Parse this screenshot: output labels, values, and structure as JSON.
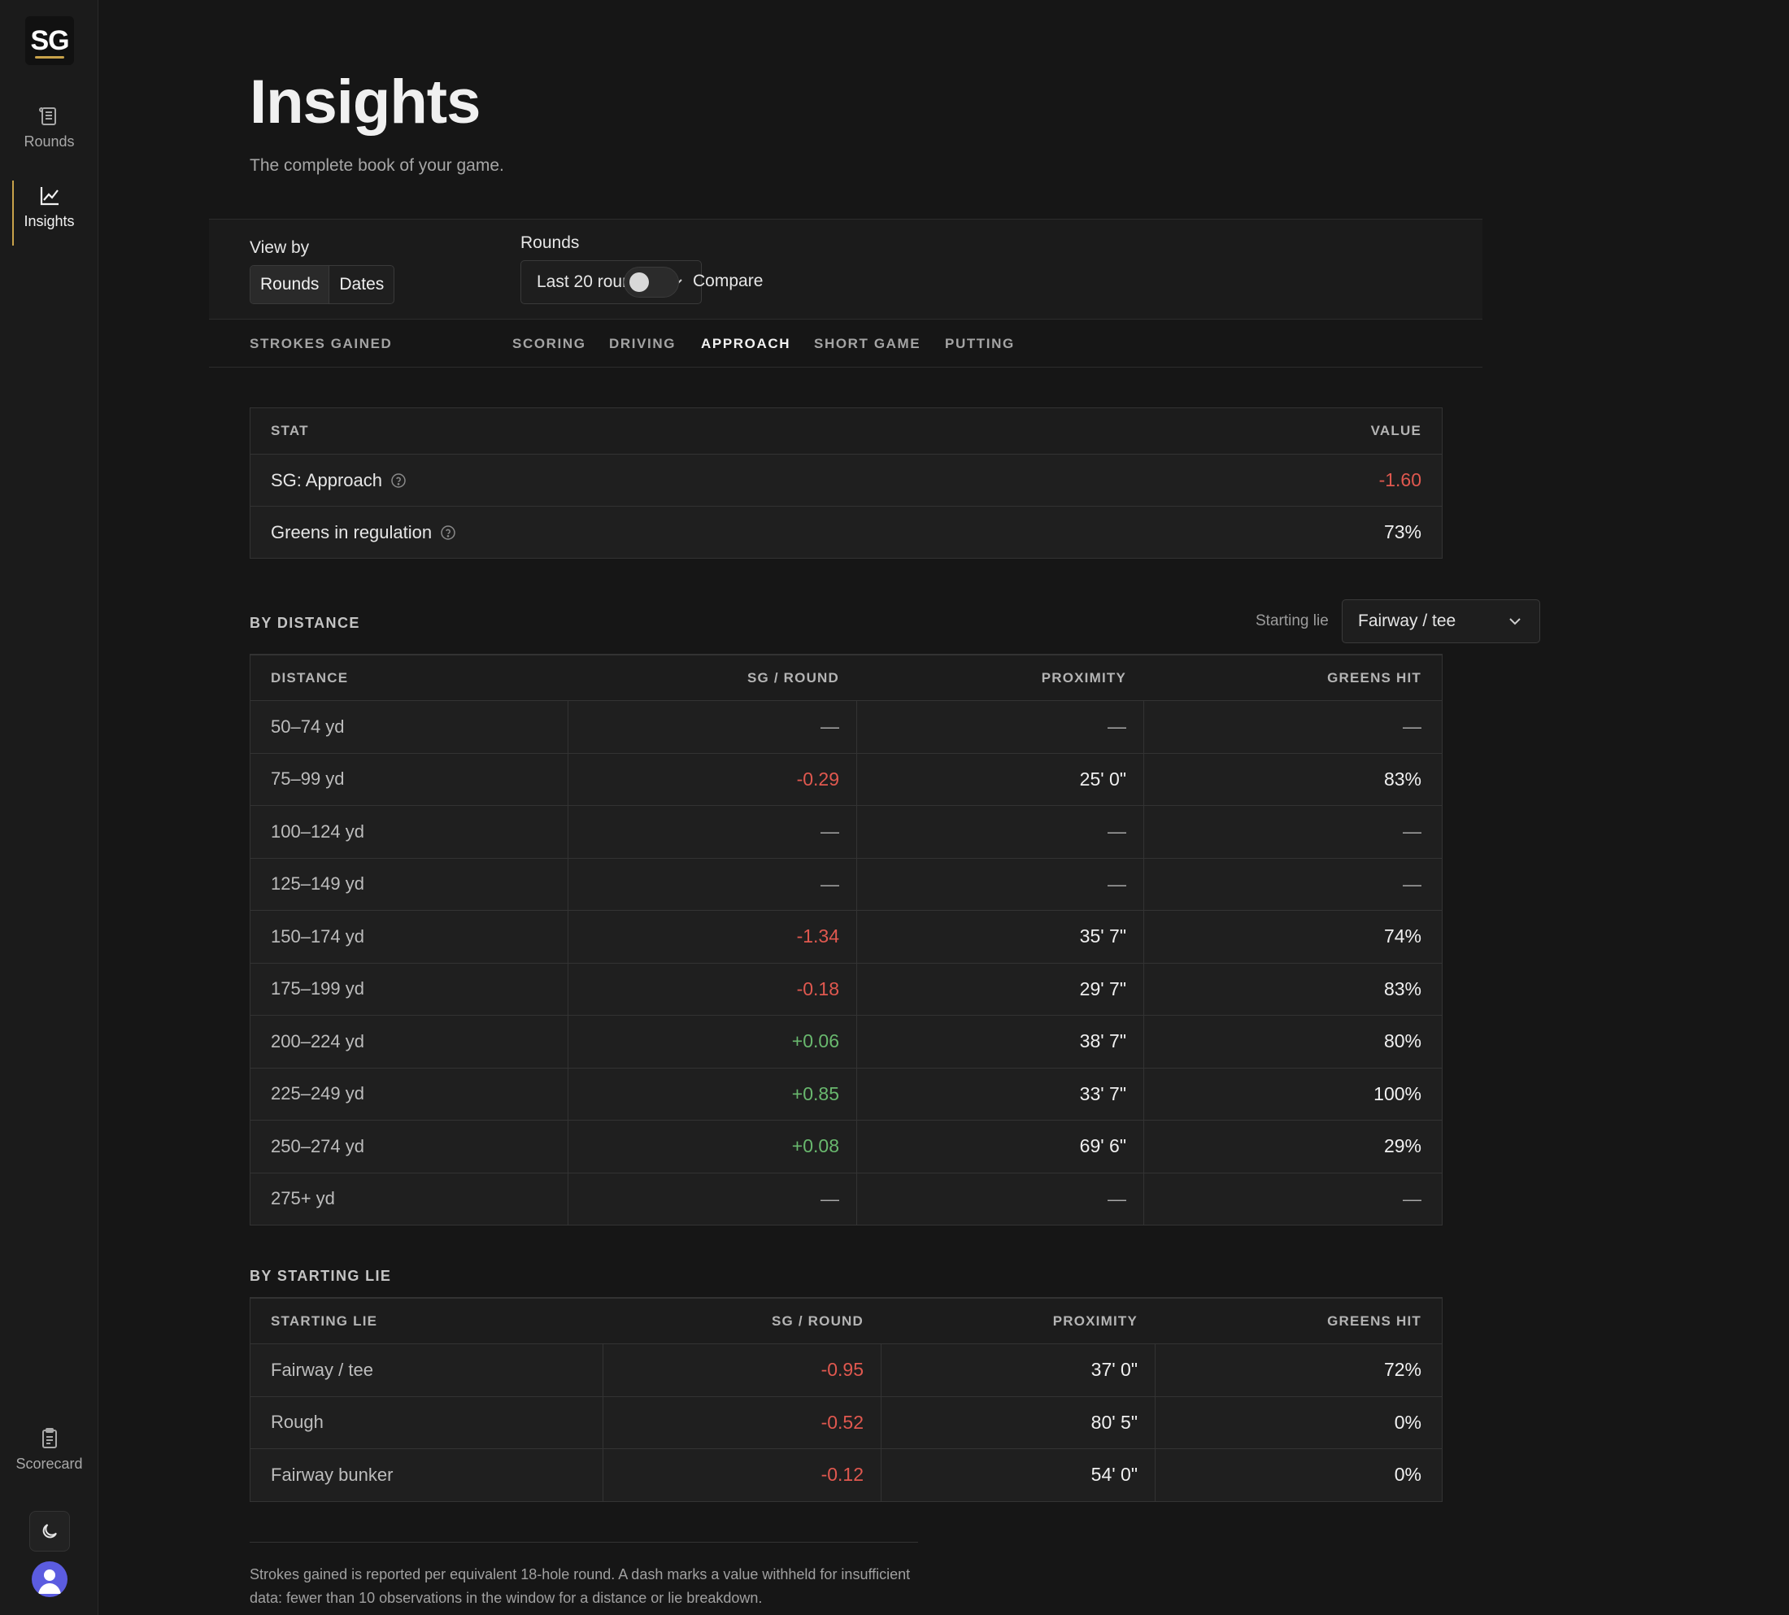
{
  "sidebar": {
    "logo": "SG",
    "nav": [
      {
        "label": "Rounds",
        "icon": "rounds-icon"
      },
      {
        "label": "Insights",
        "icon": "chart-icon"
      }
    ],
    "bottom": {
      "label": "Scorecard",
      "icon": "scorecard-icon"
    }
  },
  "page": {
    "title": "Insights",
    "subtitle": "The complete book of your game."
  },
  "controls": {
    "view_by_label": "View by",
    "view_by_options": [
      "Rounds",
      "Dates"
    ],
    "rounds_label": "Rounds",
    "rounds_value": "Last 20 rounds",
    "compare_label": "Compare"
  },
  "tabs": [
    "STROKES GAINED",
    "SCORING",
    "DRIVING",
    "APPROACH",
    "SHORT GAME",
    "PUTTING"
  ],
  "summary": {
    "headers": [
      "STAT",
      "VALUE"
    ],
    "rows": [
      {
        "stat": "SG: Approach",
        "value": "-1.60"
      },
      {
        "stat": "Greens in regulation",
        "value": "73%"
      }
    ]
  },
  "by_distance": {
    "title": "BY DISTANCE",
    "starting_lie_label": "Starting lie",
    "starting_lie_value": "Fairway / tee",
    "headers": [
      "DISTANCE",
      "SG / ROUND",
      "PROXIMITY",
      "GREENS HIT"
    ],
    "rows": [
      {
        "distance": "50–74 yd",
        "sg": "—",
        "prox": "—",
        "greens": "—"
      },
      {
        "distance": "75–99 yd",
        "sg": "-0.29",
        "prox": "25' 0\"",
        "greens": "83%"
      },
      {
        "distance": "100–124 yd",
        "sg": "—",
        "prox": "—",
        "greens": "—"
      },
      {
        "distance": "125–149 yd",
        "sg": "—",
        "prox": "—",
        "greens": "—"
      },
      {
        "distance": "150–174 yd",
        "sg": "-1.34",
        "prox": "35' 7\"",
        "greens": "74%"
      },
      {
        "distance": "175–199 yd",
        "sg": "-0.18",
        "prox": "29' 7\"",
        "greens": "83%"
      },
      {
        "distance": "200–224 yd",
        "sg": "+0.06",
        "prox": "38' 7\"",
        "greens": "80%"
      },
      {
        "distance": "225–249 yd",
        "sg": "+0.85",
        "prox": "33' 7\"",
        "greens": "100%"
      },
      {
        "distance": "250–274 yd",
        "sg": "+0.08",
        "prox": "69' 6\"",
        "greens": "29%"
      },
      {
        "distance": "275+ yd",
        "sg": "—",
        "prox": "—",
        "greens": "—"
      }
    ]
  },
  "by_lie": {
    "title": "BY STARTING LIE",
    "headers": [
      "STARTING LIE",
      "SG / ROUND",
      "PROXIMITY",
      "GREENS HIT"
    ],
    "rows": [
      {
        "lie": "Fairway / tee",
        "sg": "-0.95",
        "prox": "37' 0\"",
        "greens": "72%"
      },
      {
        "lie": "Rough",
        "sg": "-0.52",
        "prox": "80' 5\"",
        "greens": "0%"
      },
      {
        "lie": "Fairway bunker",
        "sg": "-0.12",
        "prox": "54' 0\"",
        "greens": "0%"
      }
    ]
  },
  "footnote": "Strokes gained is reported per equivalent 18-hole round. A dash marks a value withheld for insufficient data: fewer than 10 observations in the window for a distance or lie breakdown.",
  "colors": {
    "negative": "#e0584f",
    "positive": "#69b86e",
    "accent": "#c8a24a"
  }
}
